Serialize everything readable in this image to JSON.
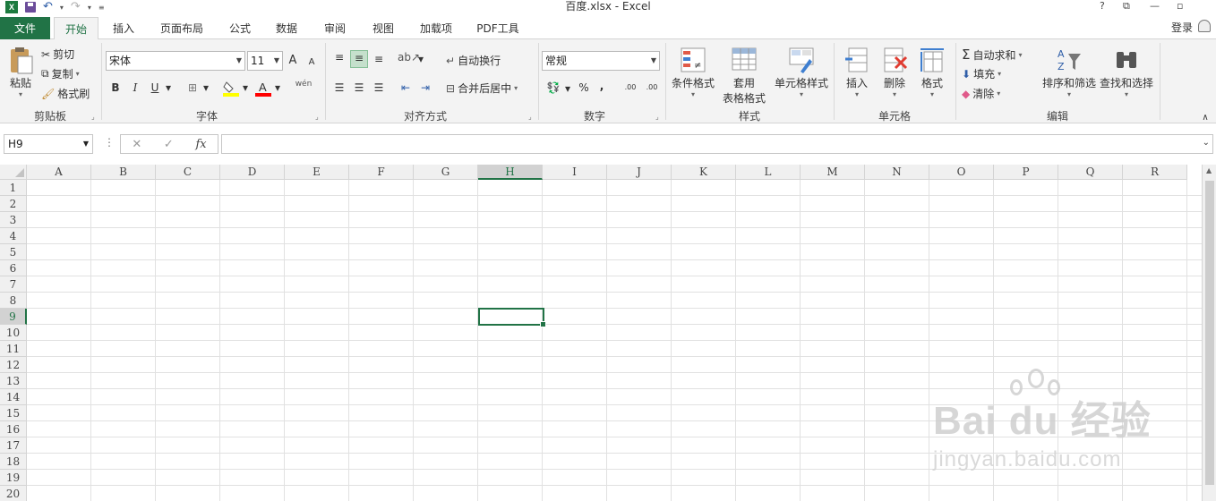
{
  "titlebar": {
    "title": "百度.xlsx - Excel",
    "help": "?",
    "restore": "⧉",
    "minimize": "—",
    "maximize": "▫"
  },
  "tabs": {
    "file": "文件",
    "items": [
      "开始",
      "插入",
      "页面布局",
      "公式",
      "数据",
      "审阅",
      "视图",
      "加载项",
      "PDF工具"
    ],
    "active_index": 0,
    "login": "登录"
  },
  "ribbon": {
    "clipboard": {
      "paste": "粘贴",
      "cut": "剪切",
      "copy": "复制",
      "format_painter": "格式刷",
      "label": "剪贴板"
    },
    "font": {
      "font_name": "宋体",
      "font_size": "11",
      "bold": "B",
      "italic": "I",
      "underline": "U",
      "increase": "A",
      "decrease": "A",
      "fill_color": "#ffff00",
      "font_color": "#ff0000",
      "phonetic": "wén",
      "label": "字体"
    },
    "alignment": {
      "wrap_text": "自动换行",
      "merge_center": "合并后居中",
      "label": "对齐方式"
    },
    "number": {
      "format": "常规",
      "percent": "%",
      "comma": ",",
      "inc_decimal": ".00",
      "dec_decimal": ".00",
      "label": "数字"
    },
    "styles": {
      "conditional": "条件格式",
      "table_format_1": "套用",
      "table_format_2": "表格格式",
      "cell_styles": "单元格样式",
      "label": "样式"
    },
    "cells": {
      "insert": "插入",
      "delete": "删除",
      "format": "格式",
      "label": "单元格"
    },
    "editing": {
      "autosum": "自动求和",
      "fill": "填充",
      "clear": "清除",
      "sort_filter": "排序和筛选",
      "find_select": "查找和选择",
      "label": "编辑"
    }
  },
  "formula_bar": {
    "name_box": "H9",
    "fx": "fx",
    "cancel": "✕",
    "enter": "✓",
    "dots": "⋮",
    "value": ""
  },
  "grid": {
    "columns": [
      "A",
      "B",
      "C",
      "D",
      "E",
      "F",
      "G",
      "H",
      "I",
      "J",
      "K",
      "L",
      "M",
      "N",
      "O",
      "P",
      "Q",
      "R"
    ],
    "rows": [
      "1",
      "2",
      "3",
      "4",
      "5",
      "6",
      "7",
      "8",
      "9",
      "10",
      "11",
      "12",
      "13",
      "14",
      "15",
      "16",
      "17",
      "18",
      "19",
      "20"
    ],
    "selected_col": "H",
    "selected_row": "9"
  },
  "watermark": {
    "brand": "Bai du 经验",
    "url": "jingyan.baidu.com"
  },
  "colors": {
    "accent": "#217346",
    "ribbon_bg": "#f3f3f3",
    "header_bg": "#f0f0f0",
    "gridline": "#e1e1e1"
  }
}
